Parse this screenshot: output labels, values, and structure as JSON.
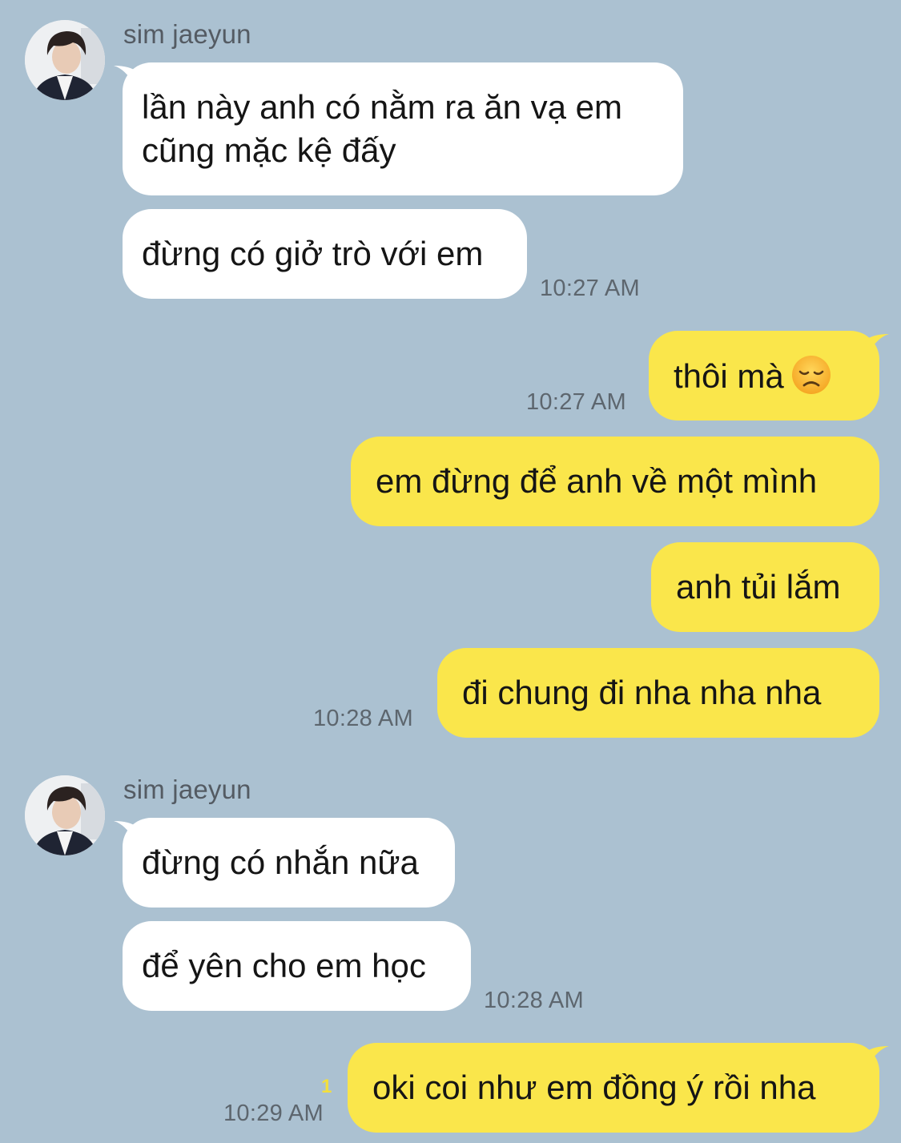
{
  "chat": {
    "groups": [
      {
        "sender": "sim jaeyun",
        "messages": [
          {
            "lines": [
              "lần này anh có nằm ra ăn vạ em",
              "cũng mặc kệ đấy"
            ]
          },
          {
            "lines": [
              "đừng có giở trò với em"
            ],
            "time": "10:27 AM"
          }
        ]
      },
      {
        "outgoing": [
          {
            "text": "thôi mà",
            "emoji": "disappointed-face-icon",
            "time": "10:27 AM"
          },
          {
            "text": "em đừng để anh về một mình"
          },
          {
            "text": "anh tủi lắm"
          },
          {
            "text": "đi chung đi nha nha nha",
            "time": "10:28 AM"
          }
        ]
      },
      {
        "sender": "sim jaeyun",
        "messages": [
          {
            "lines": [
              "đừng có nhắn nữa"
            ]
          },
          {
            "lines": [
              "để yên cho em học"
            ],
            "time": "10:28 AM"
          }
        ]
      },
      {
        "outgoing": [
          {
            "text": "oki coi như em đồng ý rồi nha",
            "unread": "1",
            "time": "10:29 AM"
          }
        ]
      }
    ]
  },
  "colors": {
    "background": "#abc1d1",
    "incoming_bubble": "#ffffff",
    "outgoing_bubble": "#fae64b",
    "timestamp": "#5d666e",
    "unread_count": "#f3df3c"
  }
}
